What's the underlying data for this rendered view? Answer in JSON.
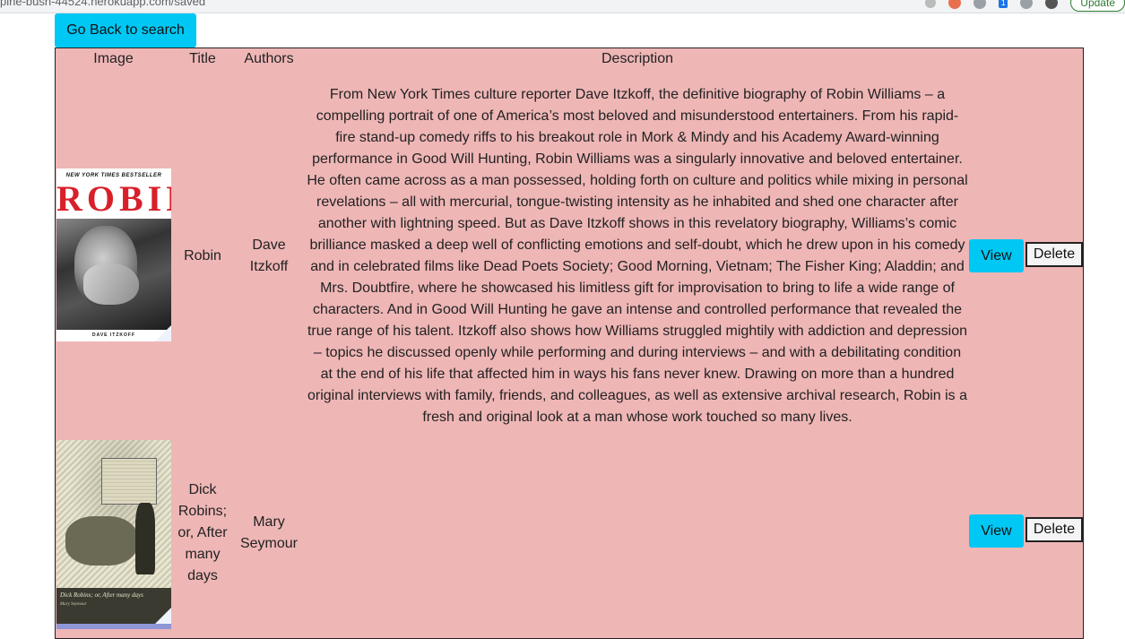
{
  "browser": {
    "url_fragment": "pine-bush-44524.herokuapp.com/saved",
    "update_label": "Update",
    "extension_badge": "1"
  },
  "page": {
    "back_button_label": "Go Back to search"
  },
  "table": {
    "headers": [
      "Image",
      "Title",
      "Authors",
      "Description"
    ],
    "rows": [
      {
        "title": "Robin",
        "authors": "Dave Itzkoff",
        "description": "From New York Times culture reporter Dave Itzkoff, the definitive biography of Robin Williams – a compelling portrait of one of America’s most beloved and misunderstood entertainers. From his rapid-fire stand-up comedy riffs to his breakout role in Mork & Mindy and his Academy Award-winning performance in Good Will Hunting, Robin Williams was a singularly innovative and beloved entertainer. He often came across as a man possessed, holding forth on culture and politics while mixing in personal revelations – all with mercurial, tongue-twisting intensity as he inhabited and shed one character after another with lightning speed. But as Dave Itzkoff shows in this revelatory biography, Williams’s comic brilliance masked a deep well of conflicting emotions and self-doubt, which he drew upon in his comedy and in celebrated films like Dead Poets Society; Good Morning, Vietnam; The Fisher King; Aladdin; and Mrs. Doubtfire, where he showcased his limitless gift for improvisation to bring to life a wide range of characters. And in Good Will Hunting he gave an intense and controlled performance that revealed the true range of his talent. Itzkoff also shows how Williams struggled mightily with addiction and depression – topics he discussed openly while performing and during interviews – and with a debilitating condition at the end of his life that affected him in ways his fans never knew. Drawing on more than a hundred original interviews with family, friends, and colleagues, as well as extensive archival research, Robin is a fresh and original look at a man whose work touched so many lives.",
        "view_label": "View",
        "delete_label": "Delete",
        "cover": {
          "banner_text": "NEW YORK TIMES BESTSELLER",
          "cover_title": "ROBIN",
          "cover_author": "DAVE ITZKOFF"
        }
      },
      {
        "title": "Dick Robins; or, After many days",
        "authors": "Mary Seymour",
        "description": "",
        "view_label": "View",
        "delete_label": "Delete",
        "cover": {
          "cover_title": "Dick Robins; or, After many days",
          "cover_author": "Mary Seymour"
        }
      }
    ]
  }
}
